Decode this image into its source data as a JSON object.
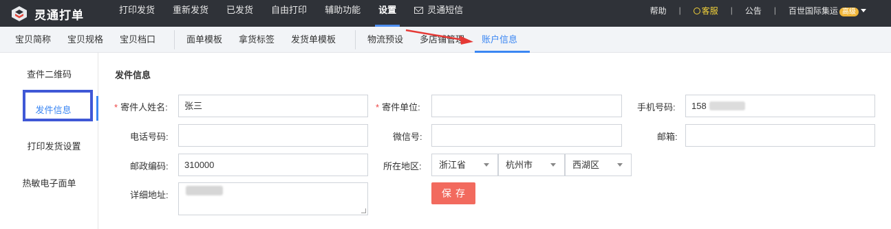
{
  "header": {
    "brand": "灵通打单",
    "nav": [
      "打印发货",
      "重新发货",
      "已发货",
      "自由打印",
      "辅助功能",
      "设置",
      "灵通短信"
    ],
    "active_nav": "设置",
    "right": {
      "help": "帮助",
      "service": "客服",
      "notice": "公告",
      "account": "百世国际集运",
      "badge": "高级"
    }
  },
  "subnav": {
    "group1": [
      "宝贝简称",
      "宝贝规格",
      "宝贝档口"
    ],
    "group2": [
      "面单模板",
      "拿货标签",
      "发货单模板"
    ],
    "group3": [
      "物流预设",
      "多店铺管理",
      "账户信息"
    ],
    "active": "账户信息"
  },
  "sidebar": {
    "items": [
      "查件二维码",
      "发件信息",
      "打印发货设置",
      "热敏电子面单"
    ],
    "active": "发件信息"
  },
  "form": {
    "section_title": "发件信息",
    "sender_name_label": "寄件人姓名:",
    "sender_name_value": "张三",
    "sender_company_label": "寄件单位:",
    "sender_company_value": "",
    "mobile_label": "手机号码:",
    "mobile_value": "158",
    "phone_label": "电话号码:",
    "phone_value": "",
    "wechat_label": "微信号:",
    "wechat_value": "",
    "email_label": "邮箱:",
    "email_value": "",
    "postcode_label": "邮政编码:",
    "postcode_value": "310000",
    "region_label": "所在地区:",
    "province": "浙江省",
    "city": "杭州市",
    "district": "西湖区",
    "address_label": "详细地址:",
    "address_value": "",
    "save_label": "保存"
  },
  "colors": {
    "accent": "#3a86f3",
    "topbar": "#2f3238",
    "save": "#f26a5e",
    "annotation": "#e53935",
    "highlight_box": "#3f58d6"
  },
  "icons": [
    "logo-icon",
    "mail-icon",
    "headset-icon",
    "caret-down-icon",
    "dropdown-arrow-icon"
  ]
}
